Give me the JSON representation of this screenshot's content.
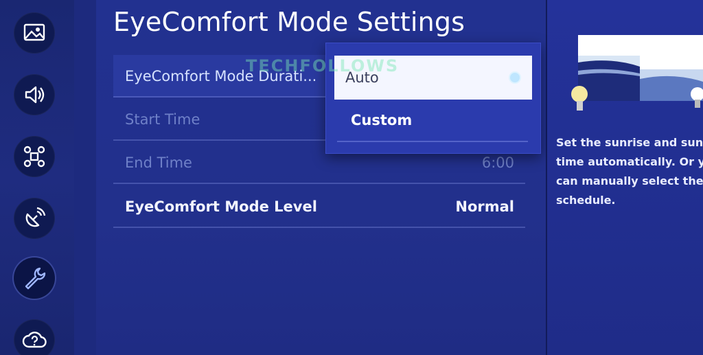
{
  "page_title": "EyeComfort Mode Settings",
  "watermark": "TECHFOLLOWS",
  "sidebar": {
    "items": [
      {
        "name": "picture-icon"
      },
      {
        "name": "sound-icon"
      },
      {
        "name": "connection-icon"
      },
      {
        "name": "broadcasting-icon"
      },
      {
        "name": "general-wrench-icon"
      },
      {
        "name": "support-icon"
      }
    ]
  },
  "settings": {
    "rows": [
      {
        "label": "EyeComfort Mode Durati...",
        "value": ""
      },
      {
        "label": "Start Time",
        "value": ""
      },
      {
        "label": "End Time",
        "value": "6:00"
      },
      {
        "label": "EyeComfort Mode Level",
        "value": "Normal"
      }
    ]
  },
  "dropdown": {
    "selected": "Auto",
    "options": [
      "Auto",
      "Custom"
    ]
  },
  "info_panel": {
    "lines": [
      "Set the sunrise and sunset",
      "time automatically. Or you",
      "can manually select the",
      "schedule."
    ]
  },
  "colors": {
    "background": "#1d2a7e",
    "focused_row": "#2a3aa0",
    "dropdown": "#2b3bad",
    "selected_option": "#f4f6ff"
  }
}
